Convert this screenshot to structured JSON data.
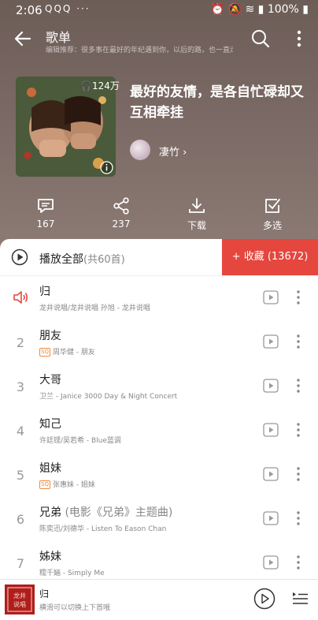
{
  "status_bar": {
    "time": "2:06",
    "notifications": "QQQ ···",
    "battery": "100%"
  },
  "header": {
    "title": "歌单",
    "subtitle": "编辑推荐：很多事在最好的年纪遇到你，以后的路，也一直走下去吧"
  },
  "playlist": {
    "play_count": "124万",
    "title": "最好的友情，是各自忙碌却又互相牵挂",
    "author": "凄竹",
    "author_chevron": "›"
  },
  "actions": [
    {
      "label": "167",
      "icon": "comment-icon"
    },
    {
      "label": "237",
      "icon": "share-icon"
    },
    {
      "label": "下载",
      "icon": "download-icon"
    },
    {
      "label": "多选",
      "icon": "multiselect-icon"
    }
  ],
  "list_header": {
    "play_all": "播放全部",
    "count": "(共60首)",
    "collect": "+ 收藏 (13672)"
  },
  "songs": [
    {
      "num": "",
      "playing": true,
      "title": "归",
      "suffix": "",
      "quality": "",
      "meta": "龙井说唱/龙井说唱 孙旭 - 龙井说唱"
    },
    {
      "num": "2",
      "playing": false,
      "title": "朋友",
      "suffix": "",
      "quality": "SQ",
      "meta": "周华健 - 朋友"
    },
    {
      "num": "3",
      "playing": false,
      "title": "大哥",
      "suffix": "",
      "quality": "",
      "meta": "卫兰 - Janice 3000 Day & Night Concert"
    },
    {
      "num": "4",
      "playing": false,
      "title": "知己",
      "suffix": "",
      "quality": "",
      "meta": "许廷铿/吴若希 - Blue蓝调"
    },
    {
      "num": "5",
      "playing": false,
      "title": "姐妹",
      "suffix": "",
      "quality": "SQ",
      "meta": "张惠妹 - 姐妹"
    },
    {
      "num": "6",
      "playing": false,
      "title": "兄弟",
      "suffix": "(电影《兄弟》主题曲)",
      "quality": "",
      "meta": "陈奕迅/刘德华 - Listen To Eason Chan"
    },
    {
      "num": "7",
      "playing": false,
      "title": "姊妹",
      "suffix": "",
      "quality": "",
      "meta": "糯千婳 - Simply Me"
    }
  ],
  "mini_player": {
    "title": "归",
    "hint": "横滑可以切换上下首哦",
    "cover_text": "龙井说唱"
  },
  "colors": {
    "accent": "#e5463e",
    "playing_icon": "#e5463e",
    "sq_badge": "#f08a3c"
  }
}
